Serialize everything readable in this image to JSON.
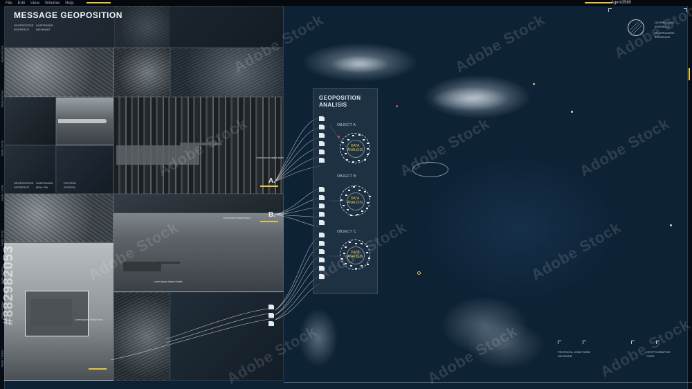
{
  "menu": {
    "items": [
      "File",
      "Edit",
      "View",
      "Window",
      "Help"
    ],
    "user": "Agent3580"
  },
  "title": "MESSAGE GEOPOSITION",
  "side_labels": [
    "Media Archive",
    "Media Archive",
    "Media Portal",
    "Media Locker",
    "Media Portal",
    "Media Archive",
    "Media Archive",
    "Media Tracker"
  ],
  "panel": {
    "title": "GEOPOSITION ANALISIS",
    "objects": [
      {
        "label": "OBJECT A",
        "line1": "DATA",
        "line2": "ANALISIS"
      },
      {
        "label": "OBJECT B",
        "line1": "DATA",
        "line2": "ANALISIS"
      },
      {
        "label": "OBJECT C",
        "line1": "DATA",
        "line2": "ANALISIS"
      }
    ]
  },
  "tags": {
    "a": "A.",
    "b": "B."
  },
  "tiny_labels": {
    "top1": "GEOPROCESS",
    "top2": "INTERFACE",
    "top3": "SUSPENDED",
    "top4": "INFORMAT",
    "right1": "GEOPROCESS",
    "right2": "INTERFACE",
    "right3": "GEOPROCESS",
    "right4": "INTERFACE",
    "mid1": "GEOPROCESS",
    "mid2": "SUSPENDED",
    "mid3": "PROTEIN",
    "mid4": "INTERFACE",
    "mid5": "MELLOW",
    "mid6": "STATION",
    "bot1": "PROTOCOL CODE SEED",
    "bot2": "DECIPHER",
    "bot3": "CRYPTOGRAPHIC",
    "bot4": "CODE"
  },
  "notes": {
    "n1": "Lorem ipsum target alpha",
    "n2": "Lorem ipsum target bravo",
    "n3": "Lorem ipsum target charlie",
    "n4": "Lorem ipsum vehicle ident"
  },
  "watermark": "Adobe Stock",
  "image_id": "#882982053",
  "colors": {
    "accent": "#e8c640",
    "background": "#0b1a28",
    "panel": "#26374a"
  }
}
